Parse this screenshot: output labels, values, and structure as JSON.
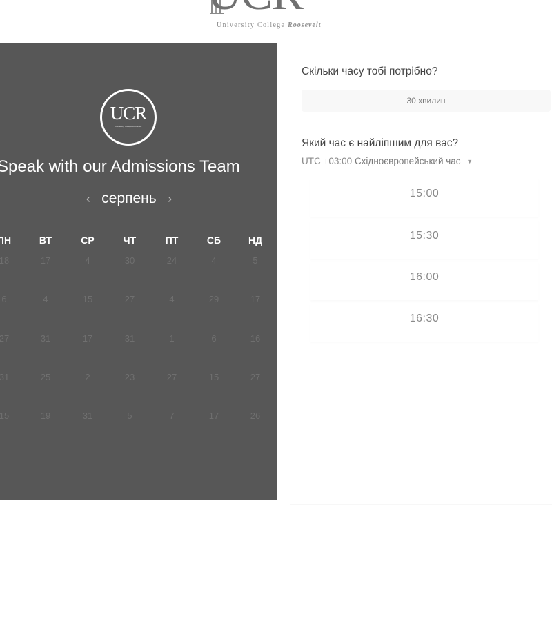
{
  "brand": {
    "logo_text": "UCR",
    "subtitle_main": "University College",
    "subtitle_emph": "Roosevelt"
  },
  "panel": {
    "logo_text": "UCR",
    "logo_subtext": "University College Roosevelt",
    "title": "Speak with our Admissions Team",
    "month": "серпень",
    "prev_arrow": "‹",
    "next_arrow": "›",
    "weekdays": [
      "ПН",
      "ВТ",
      "СР",
      "ЧТ",
      "ПТ",
      "СБ",
      "НД"
    ],
    "weeks": [
      [
        "18",
        "17",
        "4",
        "30",
        "24",
        "4",
        "5"
      ],
      [
        "6",
        "4",
        "15",
        "27",
        "4",
        "29",
        "17"
      ],
      [
        "27",
        "31",
        "17",
        "31",
        "1",
        "6",
        "16"
      ],
      [
        "31",
        "25",
        "2",
        "23",
        "27",
        "15",
        "27"
      ],
      [
        "15",
        "19",
        "31",
        "5",
        "7",
        "17",
        "26"
      ]
    ]
  },
  "form": {
    "duration_question": "Скільки часу тобі потрібно?",
    "duration_value": "30 хвилин",
    "time_question": "Який час є найліпшим для вас?",
    "timezone_offset": "UTC +03:00",
    "timezone_name": "Східноєвропейський час",
    "time_slots": [
      "15:00",
      "15:30",
      "16:00",
      "16:30"
    ]
  }
}
